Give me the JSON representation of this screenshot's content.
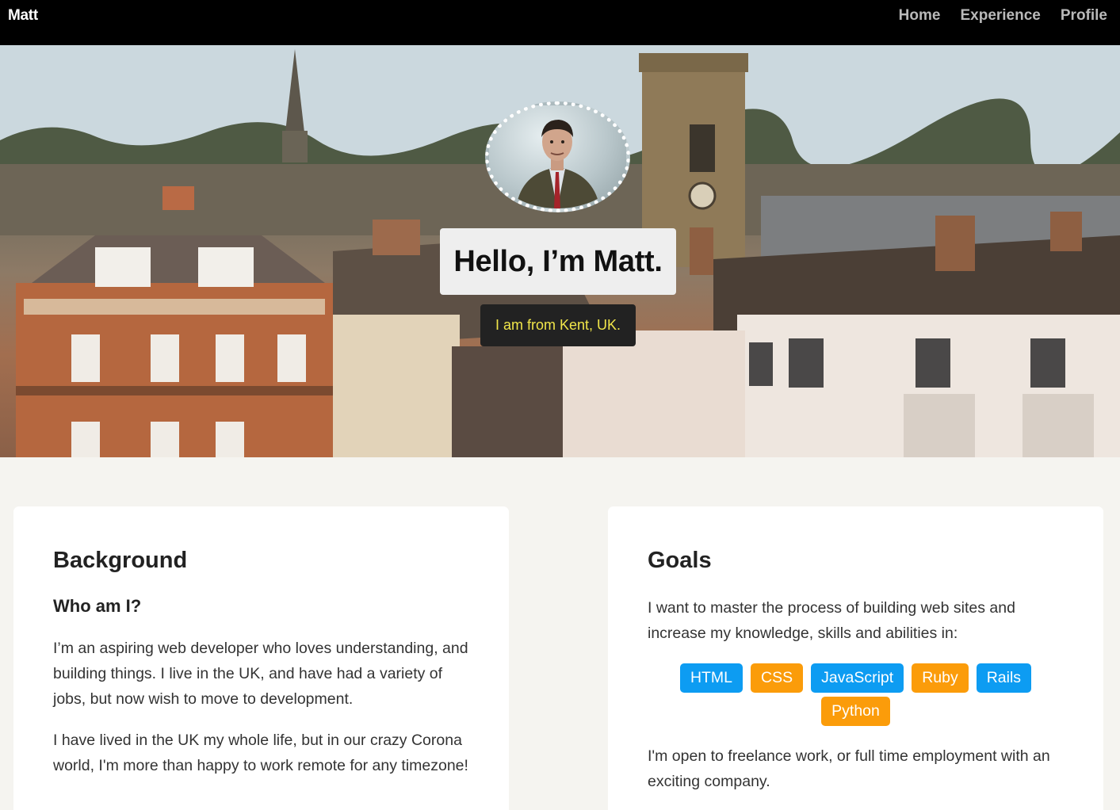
{
  "nav": {
    "brand": "Matt",
    "links": [
      "Home",
      "Experience",
      "Profile"
    ]
  },
  "hero": {
    "title": "Hello, I’m Matt.",
    "subtitle": "I am from Kent, UK."
  },
  "background": {
    "heading": "Background",
    "subheading": "Who am I?",
    "paragraphs": [
      "I’m an aspiring web developer who loves understanding, and building things. I live in the UK, and have had a variety of jobs, but now wish to move to development.",
      "I have lived in the UK my whole life, but in our crazy Corona world, I'm more than happy to work remote for any timezone!"
    ]
  },
  "goals": {
    "heading": "Goals",
    "intro": "I want to master the process of building web sites and increase my knowledge, skills and abilities in:",
    "skills": [
      {
        "label": "HTML",
        "color": "#0d9cf2"
      },
      {
        "label": "CSS",
        "color": "#fb9c0a"
      },
      {
        "label": "JavaScript",
        "color": "#0d9cf2"
      },
      {
        "label": "Ruby",
        "color": "#fb9c0a"
      },
      {
        "label": "Rails",
        "color": "#0d9cf2"
      },
      {
        "label": "Python",
        "color": "#fb9c0a"
      }
    ],
    "outro": "I'm open to freelance work, or full time employment with an exciting company."
  },
  "colors": {
    "navbar": "#000000",
    "nav_link": "#b9b9b9",
    "page_bg": "#f5f4f0",
    "subtitle_text": "#f1e64a",
    "skill_blue": "#0d9cf2",
    "skill_orange": "#fb9c0a"
  }
}
